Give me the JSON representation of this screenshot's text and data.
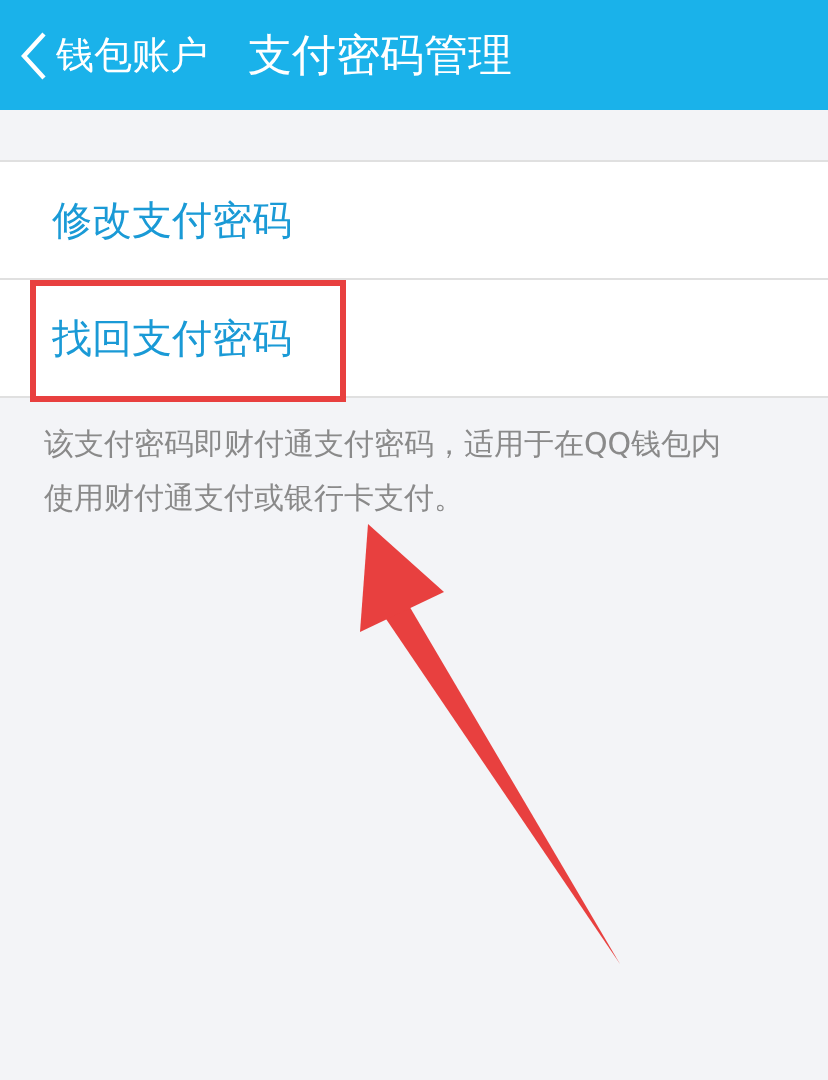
{
  "header": {
    "back_label": "钱包账户",
    "title": "支付密码管理"
  },
  "items": [
    {
      "label": "修改支付密码"
    },
    {
      "label": "找回支付密码"
    }
  ],
  "note": "该支付密码即财付通支付密码，适用于在QQ钱包内使用财付通支付或银行卡支付。"
}
